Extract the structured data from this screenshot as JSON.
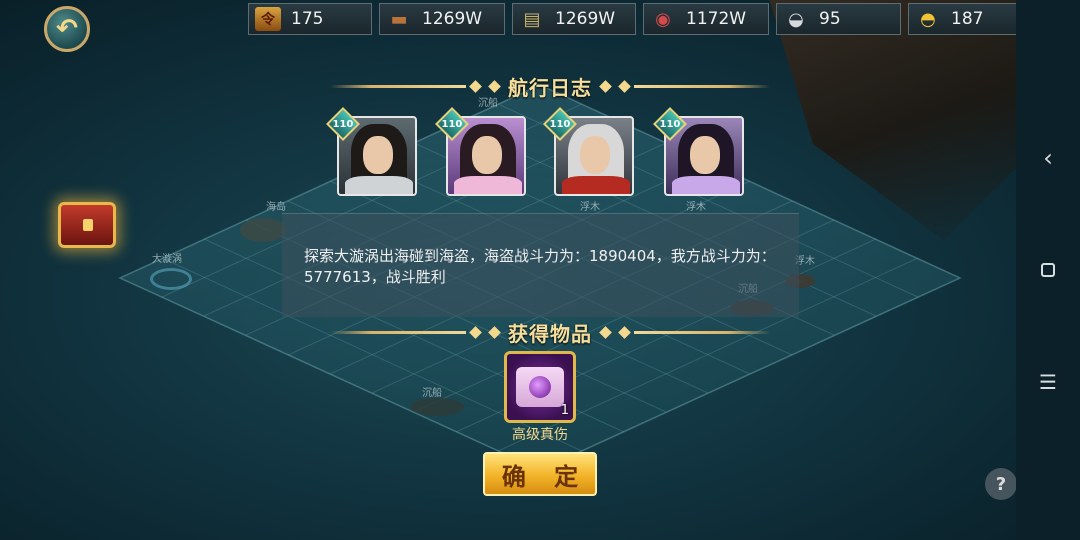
{
  "resources": [
    {
      "icon": "token-icon",
      "glyph": "令",
      "value": "175"
    },
    {
      "icon": "wood-icon",
      "glyph": "▬",
      "value": "1269W"
    },
    {
      "icon": "money-icon",
      "glyph": "▤",
      "value": "1269W"
    },
    {
      "icon": "meat-icon",
      "glyph": "◉",
      "value": "1172W"
    },
    {
      "icon": "silver-icon",
      "glyph": "◒",
      "value": "95"
    },
    {
      "icon": "gold-icon",
      "glyph": "◓",
      "value": "187"
    }
  ],
  "log": {
    "title": "航行日志",
    "heroes": [
      {
        "level": "110"
      },
      {
        "level": "110"
      },
      {
        "level": "110"
      },
      {
        "level": "110"
      }
    ],
    "message": "探索大漩涡出海碰到海盗，海盗战斗力为：1890404，我方战斗力为：5777613，战斗胜利"
  },
  "rewards": {
    "title": "获得物品",
    "item": {
      "name": "高级真伤",
      "count": "1"
    }
  },
  "confirm_label": "确 定",
  "help_label": "?",
  "map_labels": [
    "海岛",
    "大漩涡",
    "沉船",
    "浮木",
    "浮木",
    "浮木",
    "沉船",
    "沉船"
  ],
  "sysbar": {
    "back": "‹",
    "menu": "☰"
  },
  "colors": {
    "accent": "#f6df9c",
    "button": "#f3b328",
    "item_border": "#e0b94a"
  }
}
